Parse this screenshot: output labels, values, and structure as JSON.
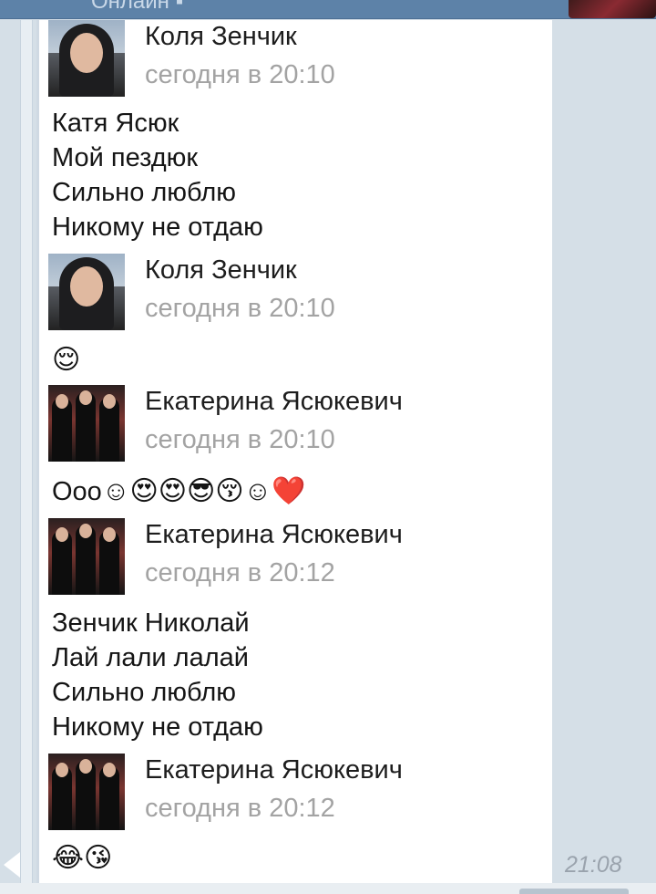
{
  "header": {
    "status": "Онлайн ▪"
  },
  "messages": [
    {
      "author": "Коля Зенчик",
      "time": "сегодня в 20:10",
      "lines": [
        "Катя Ясюк",
        "Мой пездюк",
        "Сильно люблю",
        "Никому не отдаю"
      ]
    },
    {
      "author": "Коля Зенчик",
      "time": "сегодня в 20:10",
      "emoji": "😌"
    },
    {
      "author": "Екатерина Ясюкевич",
      "time": "сегодня в 20:10",
      "text": "Ооо",
      "emoji": "☺😍😍😎😚☺❤️"
    },
    {
      "author": "Екатерина Ясюкевич",
      "time": "сегодня в 20:12",
      "lines": [
        "Зенчик Николай",
        "Лай лали лалай",
        "Сильно люблю",
        "Никому не отдаю"
      ]
    },
    {
      "author": "Екатерина Ясюкевич",
      "time": "сегодня в 20:12",
      "emoji": "😂😘"
    }
  ],
  "footer": {
    "time": "21:08"
  },
  "icons": {
    "avatar_kolya": "avatar-photo-icon",
    "avatar_katya": "avatar-photo-icon"
  }
}
